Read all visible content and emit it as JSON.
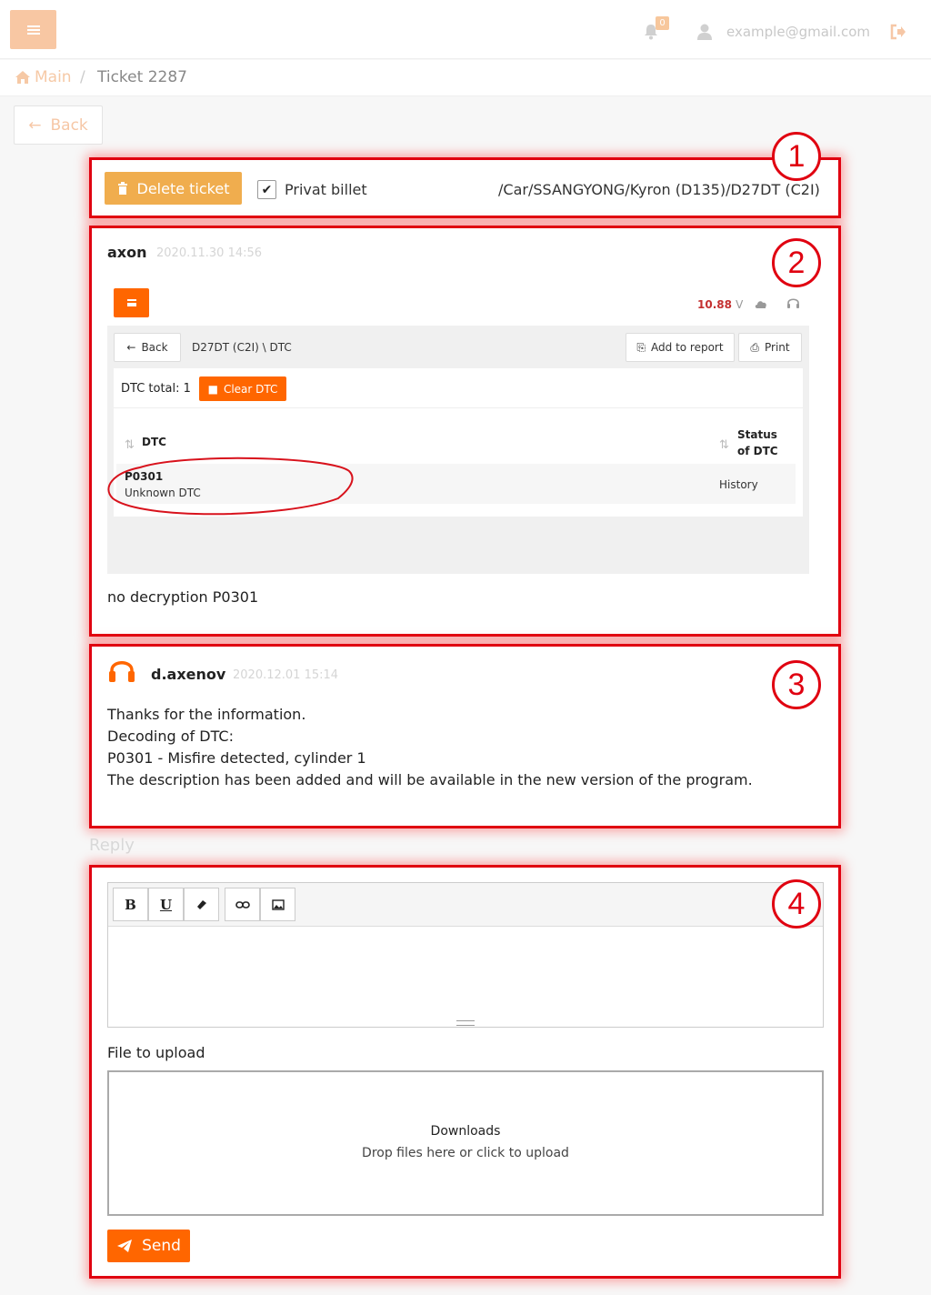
{
  "header": {
    "notification_count": "0",
    "user_email": "example@gmail.com"
  },
  "breadcrumb": {
    "home": "Main",
    "separator": "/",
    "current": "Ticket 2287"
  },
  "back_label": "Back",
  "ticket": {
    "delete_label": "Delete ticket",
    "private_label": "Privat billet",
    "private_checked": true,
    "path": "/Car/SSANGYONG/Kyron (D135)/D27DT (C2I)"
  },
  "annotations": [
    "1",
    "2",
    "3",
    "4"
  ],
  "messages": [
    {
      "author": "axon",
      "date": "2020.11.30 14:56",
      "attachment": {
        "voltage_value": "10.88",
        "voltage_unit": "V",
        "back_label": "Back",
        "path": "D27DT (C2I) \\ DTC",
        "add_report_label": "Add to report",
        "print_label": "Print",
        "dtc_total": "DTC total: 1",
        "clear_dtc_label": "Clear DTC",
        "col_dtc": "DTC",
        "col_status_1": "Status",
        "col_status_2": "of DTC",
        "rows": [
          {
            "code": "P0301",
            "description": "Unknown DTC",
            "status": "History"
          }
        ]
      },
      "text": "no decryption P0301"
    },
    {
      "author": "d.axenov",
      "date": "2020.12.01 15:14",
      "lines": [
        "Thanks for the information.",
        "Decoding of DTC:",
        "P0301 - Misfire detected, cylinder 1",
        "The description has been added and will be available in the new version of the program."
      ]
    }
  ],
  "reply": {
    "label": "Reply",
    "toolbar": {
      "bold": "B",
      "underline": "U"
    },
    "file_label": "File to upload",
    "dropzone_title": "Downloads",
    "dropzone_hint": "Drop files here or click to upload",
    "send_label": "Send"
  },
  "colors": {
    "accent": "#ff6600",
    "warning": "#f0ad4e",
    "annotation": "#e00010"
  }
}
